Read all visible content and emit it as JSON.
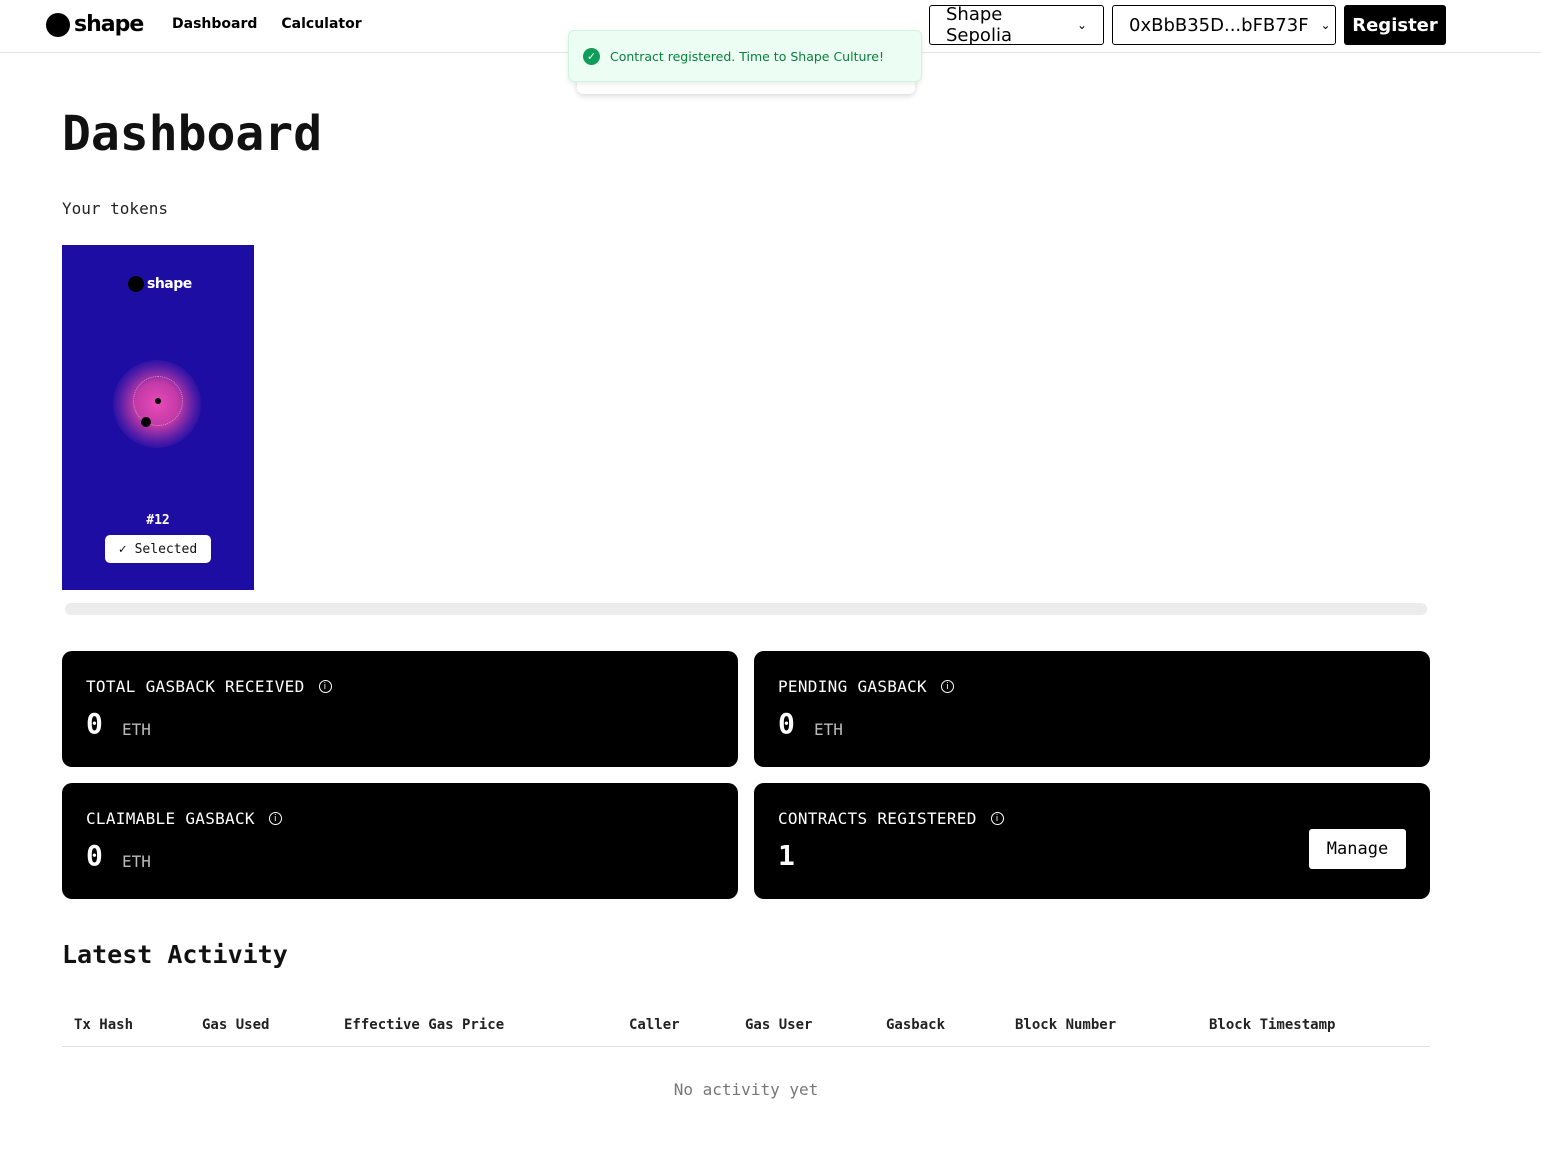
{
  "header": {
    "logo_text": "shape",
    "nav": [
      {
        "label": "Dashboard"
      },
      {
        "label": "Calculator"
      }
    ],
    "network": "Shape Sepolia",
    "account": "0xBbB35D...bFB73F",
    "register_label": "Register"
  },
  "toast": {
    "message": "Contract registered. Time to Shape Culture!",
    "icon": "check-icon"
  },
  "main": {
    "title": "Dashboard",
    "tokens_label": "Your tokens",
    "token": {
      "logo_text": "shape",
      "id": "#12",
      "selected_label": "Selected",
      "background": "#1e0da3"
    }
  },
  "stats": {
    "total": {
      "label": "TOTAL GASBACK RECEIVED",
      "value": "0",
      "unit": "ETH"
    },
    "pending": {
      "label": "PENDING GASBACK",
      "value": "0",
      "unit": "ETH"
    },
    "claimable": {
      "label": "CLAIMABLE GASBACK",
      "value": "0",
      "unit": "ETH"
    },
    "contracts": {
      "label": "CONTRACTS REGISTERED",
      "value": "1",
      "manage_label": "Manage"
    }
  },
  "activity": {
    "title": "Latest Activity",
    "columns": [
      "Tx Hash",
      "Gas Used",
      "Effective Gas Price",
      "Caller",
      "Gas User",
      "Gasback",
      "Block Number",
      "Block Timestamp"
    ],
    "empty_text": "No activity yet"
  },
  "colors": {
    "toast_bg": "#ecfdf3",
    "toast_text": "#08803c",
    "token_bg": "#1e0da3",
    "card_bg": "#000000"
  }
}
